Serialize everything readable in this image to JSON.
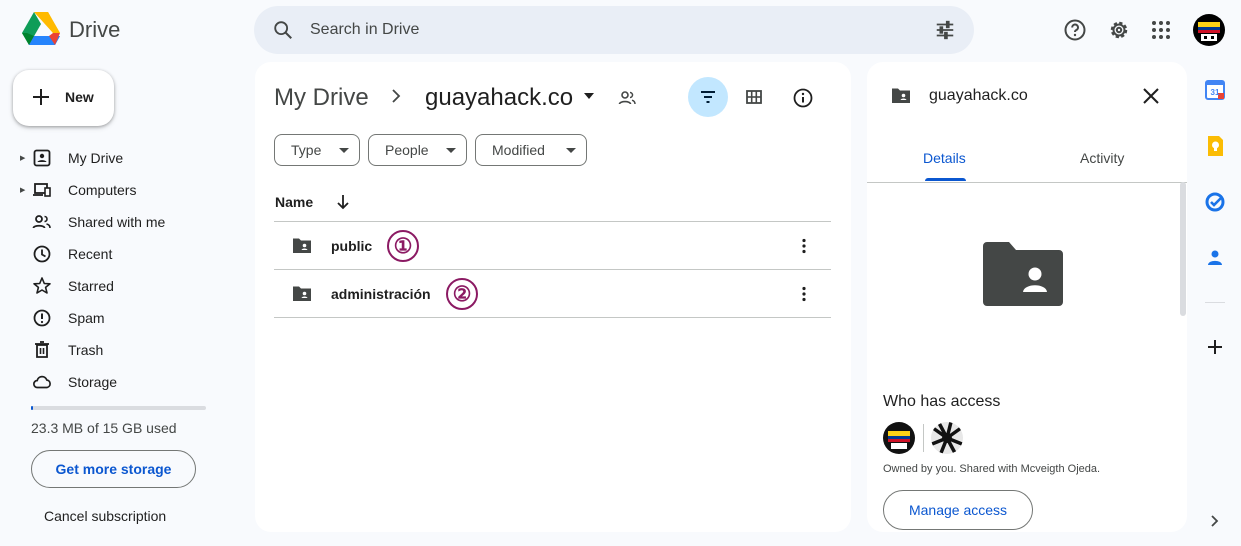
{
  "app": {
    "title": "Drive"
  },
  "search": {
    "placeholder": "Search in Drive"
  },
  "sidebar": {
    "new_label": "New",
    "items": [
      {
        "label": "My Drive"
      },
      {
        "label": "Computers"
      },
      {
        "label": "Shared with me"
      },
      {
        "label": "Recent"
      },
      {
        "label": "Starred"
      },
      {
        "label": "Spam"
      },
      {
        "label": "Trash"
      },
      {
        "label": "Storage"
      }
    ],
    "storage_used_fraction": 0.0015,
    "storage_text": "23.3 MB of 15 GB used",
    "get_storage_label": "Get more storage",
    "cancel_label": "Cancel subscription"
  },
  "main": {
    "breadcrumb_root": "My Drive",
    "breadcrumb_current": "guayahack.co",
    "chips": [
      "Type",
      "People",
      "Modified"
    ],
    "column_name": "Name",
    "files": [
      {
        "name": "public",
        "badge": "①"
      },
      {
        "name": "administración",
        "badge": "②"
      }
    ]
  },
  "details": {
    "title": "guayahack.co",
    "tabs": [
      "Details",
      "Activity"
    ],
    "who_has_access": "Who has access",
    "owned_text": "Owned by you. Shared with Mcveigth Ojeda.",
    "manage_label": "Manage access"
  },
  "colors": {
    "accent": "#0b57d0",
    "filter_active": "#c2e7ff",
    "badge": "#8b1a63"
  }
}
